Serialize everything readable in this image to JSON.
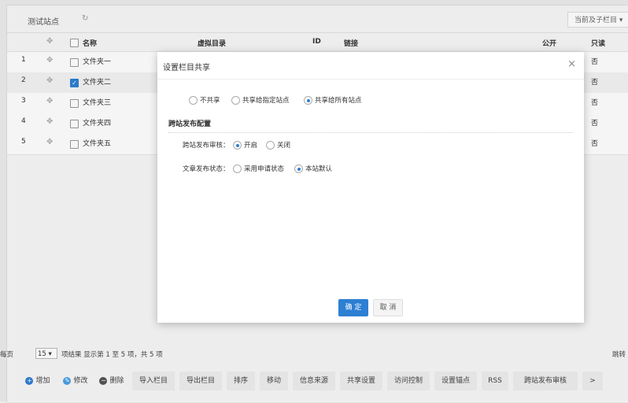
{
  "site": {
    "title": "测试站点",
    "refresh_icon": "refresh-icon"
  },
  "scope_select": "当前及子栏目",
  "table": {
    "headers": {
      "name": "名称",
      "virtual_dir": "虚拟目录",
      "id": "ID",
      "link": "链接",
      "public": "公开",
      "readonly": "只读"
    },
    "rows": [
      {
        "num": "1",
        "name": "文件夹一",
        "readonly": "否",
        "checked": false
      },
      {
        "num": "2",
        "name": "文件夹二",
        "readonly": "否",
        "checked": true
      },
      {
        "num": "3",
        "name": "文件夹三",
        "readonly": "否",
        "checked": false
      },
      {
        "num": "4",
        "name": "文件夹四",
        "readonly": "否",
        "checked": false
      },
      {
        "num": "5",
        "name": "文件夹五",
        "readonly": "否",
        "checked": false
      }
    ]
  },
  "modal": {
    "title": "设置栏目共享",
    "share_options": [
      "不共享",
      "共享给指定站点",
      "共享给所有站点"
    ],
    "share_selected": 2,
    "section_title": "跨站发布配置",
    "review_label": "跨站发布审核：",
    "review_options": [
      "开启",
      "关闭"
    ],
    "review_selected": 0,
    "status_label": "文章发布状态：",
    "status_options": [
      "采用申请状态",
      "本站默认"
    ],
    "status_selected": 1,
    "ok": "确 定",
    "cancel": "取 消"
  },
  "footer": {
    "per_page_label": "每页",
    "per_page_value": "15",
    "summary": "项结果 显示第 1 至 5 项，共 5 项",
    "jump": "跳转"
  },
  "toolbar": [
    "增加",
    "修改",
    "删除",
    "导入栏目",
    "导出栏目",
    "排序",
    "移动",
    "信息来源",
    "共享设置",
    "访问控制",
    "设置锚点",
    "RSS",
    "跨站发布审核",
    ">"
  ],
  "colors": {
    "accent": "#2d7fd3",
    "add": "#2d7fd3",
    "edit": "#4aa0e6",
    "delete": "#555555"
  }
}
